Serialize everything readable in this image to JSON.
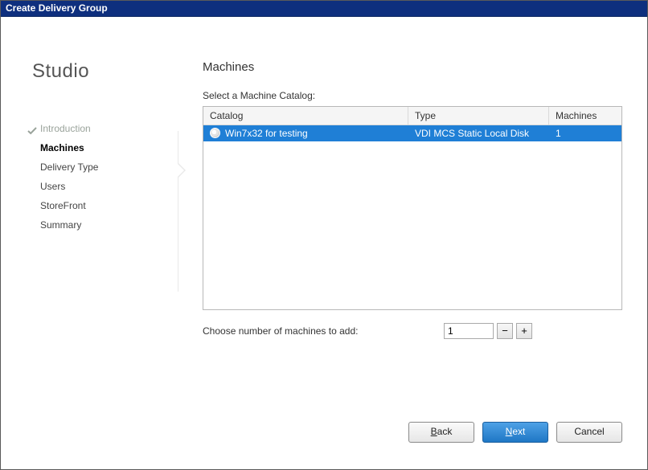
{
  "window": {
    "title": "Create Delivery Group"
  },
  "sidebar": {
    "brand": "Studio",
    "steps": [
      {
        "label": "Introduction",
        "state": "done"
      },
      {
        "label": "Machines",
        "state": "current"
      },
      {
        "label": "Delivery Type",
        "state": "pending"
      },
      {
        "label": "Users",
        "state": "pending"
      },
      {
        "label": "StoreFront",
        "state": "pending"
      },
      {
        "label": "Summary",
        "state": "pending"
      }
    ]
  },
  "main": {
    "title": "Machines",
    "instruction": "Select a Machine Catalog:",
    "columns": {
      "catalog": "Catalog",
      "type": "Type",
      "machines": "Machines"
    },
    "rows": [
      {
        "catalog": "Win7x32 for testing",
        "type": "VDI MCS Static Local Disk",
        "machines": "1",
        "selected": true
      }
    ],
    "choose_label": "Choose number of machines to add:",
    "choose_value": "1",
    "minus": "−",
    "plus": "+"
  },
  "footer": {
    "back_u": "B",
    "back_rest": "ack",
    "next_u": "N",
    "next_rest": "ext",
    "cancel": "Cancel"
  }
}
